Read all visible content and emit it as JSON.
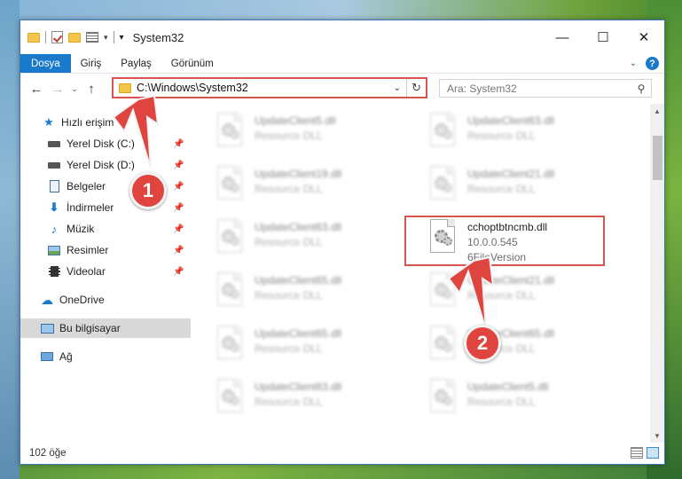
{
  "window": {
    "title": "System32",
    "controls": {
      "minimize": "—",
      "maximize": "☐",
      "close": "✕"
    }
  },
  "ribbon": {
    "tabs": [
      "Dosya",
      "Giriş",
      "Paylaş",
      "Görünüm"
    ],
    "help": "?"
  },
  "nav": {
    "back": "←",
    "forward": "→",
    "recent": "⌄",
    "up": "↑",
    "address": "C:\\Windows\\System32",
    "search_placeholder": "Ara: System32"
  },
  "sidebar": {
    "items": [
      {
        "label": "Hızlı erişim",
        "icon": "star-icon",
        "pinned": false
      },
      {
        "label": "Yerel Disk (C:)",
        "icon": "drive-icon",
        "pinned": true
      },
      {
        "label": "Yerel Disk (D:)",
        "icon": "drive-icon",
        "pinned": true
      },
      {
        "label": "Belgeler",
        "icon": "document-icon",
        "pinned": true
      },
      {
        "label": "İndirmeler",
        "icon": "download-icon",
        "pinned": true
      },
      {
        "label": "Müzik",
        "icon": "music-icon",
        "pinned": true
      },
      {
        "label": "Resimler",
        "icon": "pictures-icon",
        "pinned": true
      },
      {
        "label": "Videolar",
        "icon": "video-icon",
        "pinned": true
      },
      {
        "label": "OneDrive",
        "icon": "cloud-icon",
        "pinned": false
      },
      {
        "label": "Bu bilgisayar",
        "icon": "computer-icon",
        "pinned": false
      },
      {
        "label": "Ağ",
        "icon": "network-icon",
        "pinned": false
      }
    ]
  },
  "files": [
    {
      "name": "UpdateClient5.dll",
      "meta1": "Resource DLL",
      "meta2": ""
    },
    {
      "name": "UpdateClient63.dll",
      "meta1": "Resource DLL",
      "meta2": ""
    },
    {
      "name": "UpdateClient19.dll",
      "meta1": "Resource DLL",
      "meta2": ""
    },
    {
      "name": "UpdateClient21.dll",
      "meta1": "Resource DLL",
      "meta2": ""
    },
    {
      "name": "UpdateClient63.dll",
      "meta1": "Resource DLL",
      "meta2": ""
    },
    {
      "name": "cchoptbtncmb.dll",
      "meta1": "10.0.0.545",
      "meta2": "6FileVersion"
    },
    {
      "name": "UpdateClient65.dll",
      "meta1": "Resource DLL",
      "meta2": ""
    },
    {
      "name": "UpdateClient21.dll",
      "meta1": "Resource DLL",
      "meta2": ""
    },
    {
      "name": "UpdateClient65.dll",
      "meta1": "Resource DLL",
      "meta2": ""
    },
    {
      "name": "UpdateClient65.dll",
      "meta1": "Resource DLL",
      "meta2": ""
    },
    {
      "name": "UpdateClient63.dll",
      "meta1": "Resource DLL",
      "meta2": ""
    },
    {
      "name": "UpdateClient5.dll",
      "meta1": "Resource DLL",
      "meta2": ""
    }
  ],
  "status": {
    "count": "102 öğe"
  },
  "callouts": {
    "first": "1",
    "second": "2"
  },
  "colors": {
    "accent": "#1979ca",
    "highlight": "#d9534f",
    "badge": "#e0443e"
  }
}
